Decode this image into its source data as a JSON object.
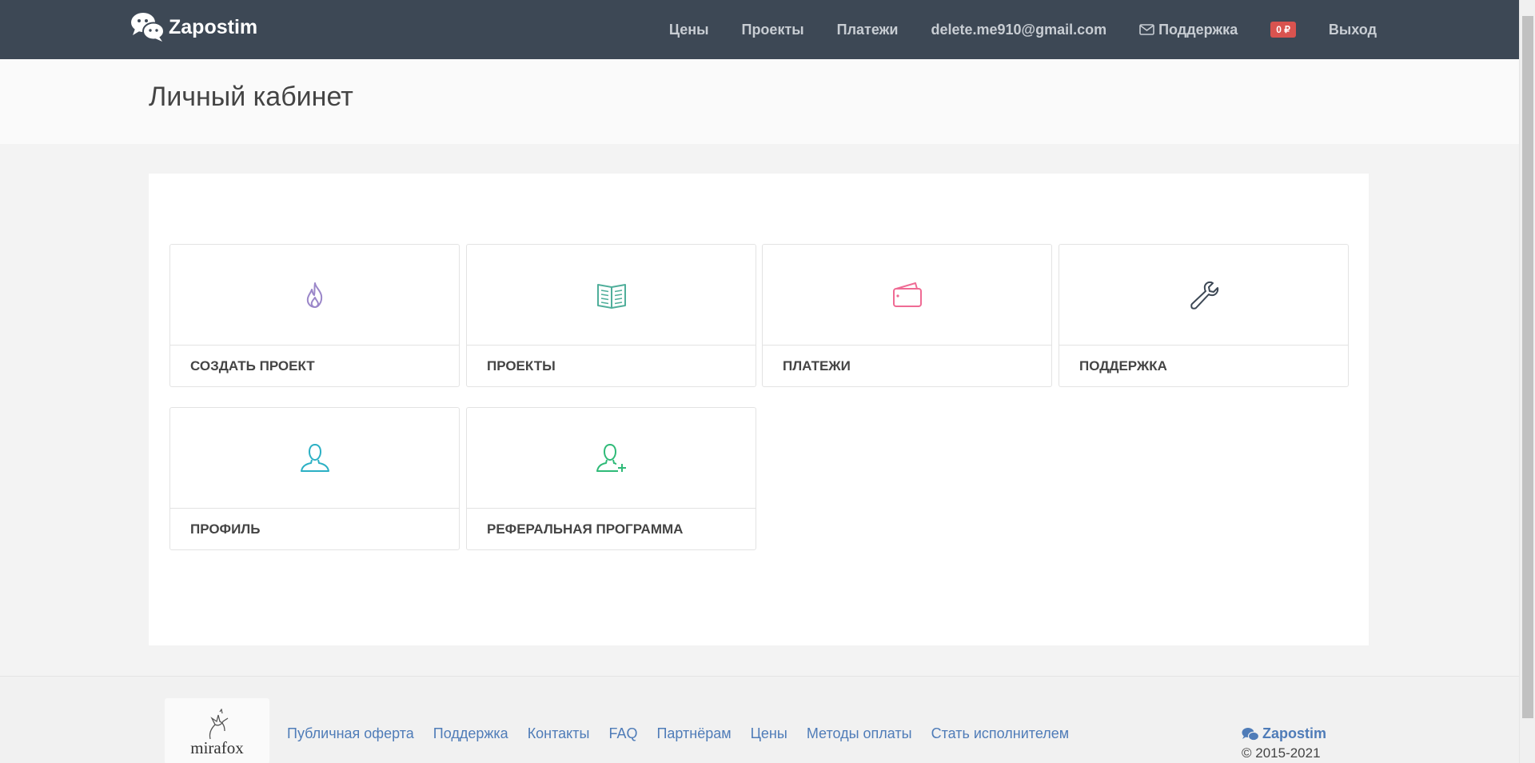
{
  "brand": {
    "name": "Zapostim",
    "icon": "chat-bubbles-icon"
  },
  "nav": {
    "prices": "Цены",
    "projects": "Проекты",
    "payments": "Платежи",
    "email": "delete.me910@gmail.com",
    "support": "Поддержка",
    "balance": "0 ₽",
    "logout": "Выход"
  },
  "page": {
    "title": "Личный кабинет"
  },
  "tiles": [
    {
      "label": "СОЗДАТЬ ПРОЕКТ",
      "icon": "flame-icon",
      "color": "#9b87c9"
    },
    {
      "label": "ПРОЕКТЫ",
      "icon": "book-icon",
      "color": "#4fae9a"
    },
    {
      "label": "ПЛАТЕЖИ",
      "icon": "wallet-icon",
      "color": "#ef6b94"
    },
    {
      "label": "ПОДДЕРЖКА",
      "icon": "wrench-icon",
      "color": "#3d4855"
    },
    {
      "label": "ПРОФИЛЬ",
      "icon": "user-icon",
      "color": "#2bb0c4"
    },
    {
      "label": "РЕФЕРАЛЬНАЯ ПРОГРАММА",
      "icon": "user-add-icon",
      "color": "#2fba78"
    }
  ],
  "footer": {
    "logo_text": "mirafox",
    "links": [
      "Публичная оферта",
      "Поддержка",
      "Контакты",
      "FAQ",
      "Партнёрам",
      "Цены",
      "Методы оплаты",
      "Стать исполнителем"
    ],
    "brand": "Zapostim",
    "copyright": "© 2015-2021"
  }
}
